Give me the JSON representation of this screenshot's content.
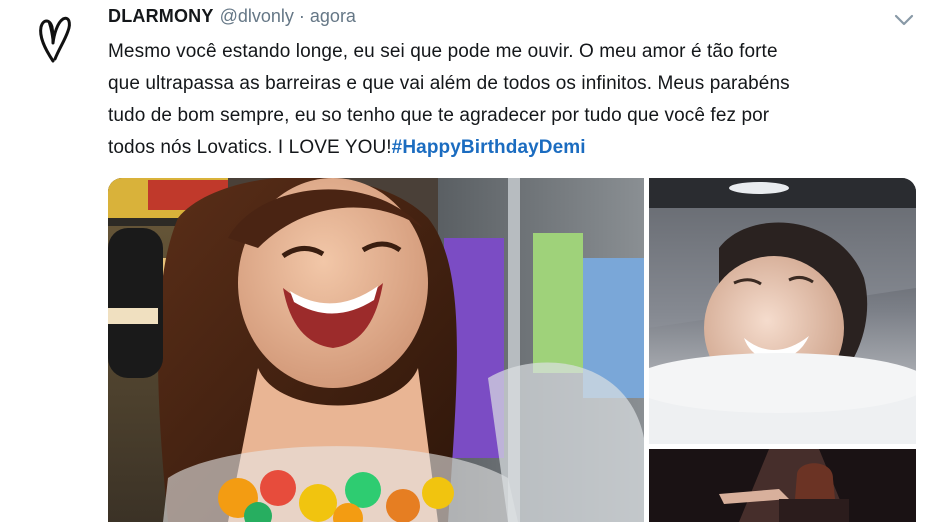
{
  "tweet": {
    "display_name": "DLARMONY",
    "handle": "@dlvonly",
    "separator": "·",
    "time": "agora",
    "text_lines": [
      "Mesmo você estando longe, eu sei que pode me ouvir. O meu amor é tão forte",
      "que ultrapassa as barreiras e que vai além de todos os infinitos. Meus parabéns",
      "tudo de bom sempre, eu so tenho que te agradecer por tudo que você fez por",
      "todos nós Lovatics. I LOVE YOU!"
    ],
    "hashtag": "#HappyBirthdayDemi"
  },
  "icons": {
    "avatar": "heart-scribble-logo",
    "menu": "chevron-down-icon"
  },
  "colors": {
    "text": "#14171a",
    "secondary": "#657786",
    "hashtag": "#1b6cc0"
  }
}
